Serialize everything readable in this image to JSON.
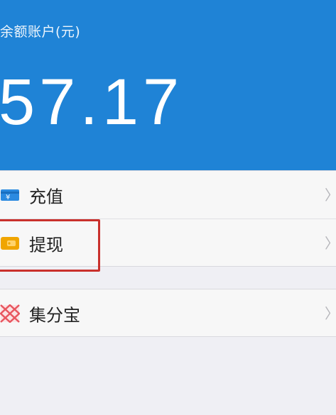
{
  "header": {
    "label": "余额账户(元)",
    "amount": "57.17",
    "background_color": "#1f83d6"
  },
  "menu": {
    "items": [
      {
        "label": "充值",
        "icon": "recharge-card-icon",
        "icon_color": "#2b8ae0"
      },
      {
        "label": "提现",
        "icon": "wallet-icon",
        "icon_color": "#f0a500"
      },
      {
        "label": "集分宝",
        "icon": "jifenbao-icon",
        "icon_color": "#e8565f"
      }
    ],
    "chevron": "〉"
  },
  "annotation": {
    "highlight_color": "#c9302c",
    "highlighted_item": "提现"
  }
}
